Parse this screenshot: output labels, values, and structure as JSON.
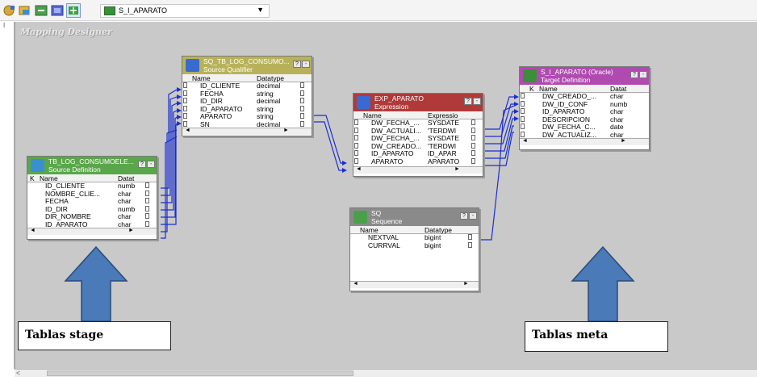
{
  "toolbar": {
    "selected_mapping": "S_I_APARATO",
    "icons": [
      "sources-icon",
      "targets-icon",
      "transformations-icon",
      "mapplets-icon",
      "mappings-icon"
    ]
  },
  "canvas": {
    "title": "Mapping Designer"
  },
  "sq_tb_log": {
    "title": "SQ_TB_LOG_CONSUMO...",
    "subtitle": "Source Qualifier",
    "columns": [
      "Name",
      "Datatype"
    ],
    "rows": [
      [
        "ID_CLIENTE",
        "decimal"
      ],
      [
        "FECHA",
        "string"
      ],
      [
        "ID_DIR",
        "decimal"
      ],
      [
        "ID_APARATO",
        "string"
      ],
      [
        "APARATO",
        "string"
      ],
      [
        "SN",
        "decimal"
      ]
    ]
  },
  "src_tb_log": {
    "title": "TB_LOG_CONSUMOELE...",
    "subtitle": "Source Definition",
    "columns": [
      "K",
      "Name",
      "Datat"
    ],
    "rows": [
      [
        "ID_CLIENTE",
        "numb"
      ],
      [
        "NOMBRE_CLIE...",
        "char"
      ],
      [
        "FECHA",
        "char"
      ],
      [
        "ID_DIR",
        "numb"
      ],
      [
        "DIR_NOMBRE",
        "char"
      ],
      [
        "ID_APARATO",
        "char"
      ]
    ]
  },
  "exp_aparato": {
    "title": "EXP_APARATO",
    "subtitle": "Expression",
    "columns": [
      "Name",
      "Expressio"
    ],
    "rows": [
      [
        "DW_FECHA_...",
        "SYSDATE"
      ],
      [
        "DW_ACTUALI...",
        "'TERDWI"
      ],
      [
        "DW_FECHA_...",
        "SYSDATE"
      ],
      [
        "DW_CREADO...",
        "'TERDWI"
      ],
      [
        "ID_APARATO",
        "ID_APAR"
      ],
      [
        "APARATO",
        "APARATO"
      ]
    ]
  },
  "sq_sequence": {
    "title": "SQ",
    "subtitle": "Sequence",
    "columns": [
      "Name",
      "Datatype"
    ],
    "rows": [
      [
        "NEXTVAL",
        "bigint"
      ],
      [
        "CURRVAL",
        "bigint"
      ]
    ]
  },
  "target_aparato": {
    "title": "S_I_APARATO (Oracle)",
    "subtitle": "Target Definition",
    "columns": [
      "K",
      "Name",
      "Datat"
    ],
    "rows": [
      [
        "DW_CREADO_...",
        "char"
      ],
      [
        "DW_ID_CONF",
        "numb"
      ],
      [
        "ID_APARATO",
        "char"
      ],
      [
        "DESCRIPCION",
        "char"
      ],
      [
        "DW_FECHA_C...",
        "date"
      ],
      [
        "DW_ACTUALIZ...",
        "char"
      ]
    ]
  },
  "annotations": {
    "left_label": "Tablas stage",
    "right_label": "Tablas meta",
    "arrow_color": "#4a7ab8"
  },
  "colors": {
    "source_qualifier": "#b7b25a",
    "source_def": "#5aa64a",
    "expression": "#b03a3a",
    "sequence": "#8a8a8a",
    "target_def": "#b04ab0",
    "link": "#1a2fd0"
  }
}
